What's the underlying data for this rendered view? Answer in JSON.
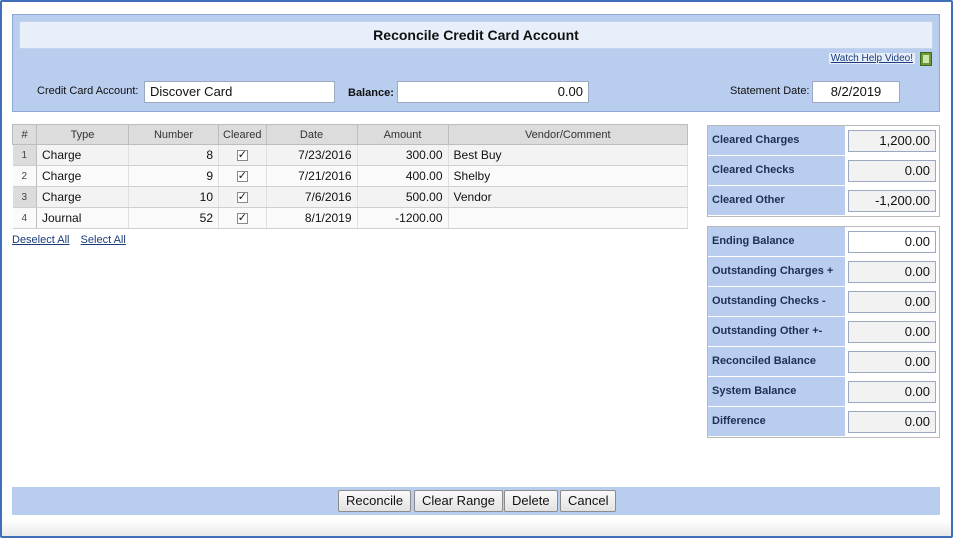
{
  "title": "Reconcile Credit Card Account",
  "help_link": "Watch Help Video!",
  "account": {
    "label": "Credit Card Account:",
    "value": "Discover Card",
    "balance_label": "Balance:",
    "balance_value": "0.00",
    "statement_label": "Statement Date:",
    "statement_value": "8/2/2019"
  },
  "table": {
    "headers": [
      "#",
      "Type",
      "Number",
      "Cleared",
      "Date",
      "Amount",
      "Vendor/Comment"
    ],
    "rows": [
      {
        "num": "1",
        "type": "Charge",
        "number": "8",
        "cleared": true,
        "date": "7/23/2016",
        "amount": "300.00",
        "vendor": "Best Buy"
      },
      {
        "num": "2",
        "type": "Charge",
        "number": "9",
        "cleared": true,
        "date": "7/21/2016",
        "amount": "400.00",
        "vendor": "Shelby"
      },
      {
        "num": "3",
        "type": "Charge",
        "number": "10",
        "cleared": true,
        "date": "7/6/2016",
        "amount": "500.00",
        "vendor": "Vendor"
      },
      {
        "num": "4",
        "type": "Journal",
        "number": "52",
        "cleared": true,
        "date": "8/1/2019",
        "amount": "-1200.00",
        "vendor": ""
      }
    ]
  },
  "links": {
    "deselect_all": "Deselect All",
    "select_all": "Select All"
  },
  "cleared_summary": [
    {
      "label": "Cleared Charges",
      "value": "1,200.00"
    },
    {
      "label": "Cleared Checks",
      "value": "0.00"
    },
    {
      "label": "Cleared Other",
      "value": "-1,200.00"
    }
  ],
  "balance_summary": [
    {
      "label": "Ending Balance",
      "value": "0.00"
    },
    {
      "label": "Outstanding Charges +",
      "value": "0.00"
    },
    {
      "label": "Outstanding Checks -",
      "value": "0.00"
    },
    {
      "label": "Outstanding Other +-",
      "value": "0.00"
    },
    {
      "label": "Reconciled Balance",
      "value": "0.00"
    },
    {
      "label": "System Balance",
      "value": "0.00"
    },
    {
      "label": "Difference",
      "value": "0.00"
    }
  ],
  "buttons": {
    "reconcile": "Reconcile",
    "clear_range": "Clear Range",
    "delete": "Delete",
    "cancel": "Cancel"
  },
  "colors": {
    "panel": "#b9cdee",
    "title_bg": "#e8effb",
    "link": "#1a3c7a"
  }
}
